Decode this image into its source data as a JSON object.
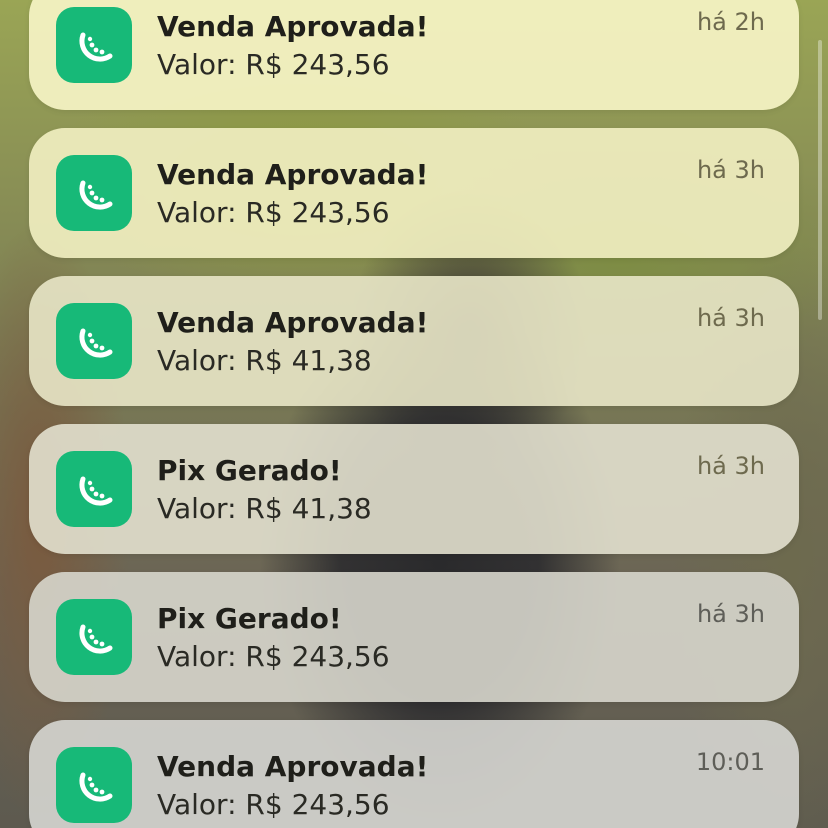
{
  "app": {
    "icon": "melon-slice-icon",
    "icon_color": "#17b978"
  },
  "notifications": [
    {
      "title": "Venda Aprovada!",
      "body": "Valor: R$ 243,56",
      "time": "há 2h"
    },
    {
      "title": "Venda Aprovada!",
      "body": "Valor: R$ 243,56",
      "time": "há 3h"
    },
    {
      "title": "Venda Aprovada!",
      "body": "Valor: R$ 41,38",
      "time": "há 3h"
    },
    {
      "title": "Pix Gerado!",
      "body": "Valor: R$ 41,38",
      "time": "há 3h"
    },
    {
      "title": "Pix Gerado!",
      "body": "Valor: R$ 243,56",
      "time": "há 3h"
    },
    {
      "title": "Venda Aprovada!",
      "body": "Valor: R$ 243,56",
      "time": "10:01"
    }
  ]
}
